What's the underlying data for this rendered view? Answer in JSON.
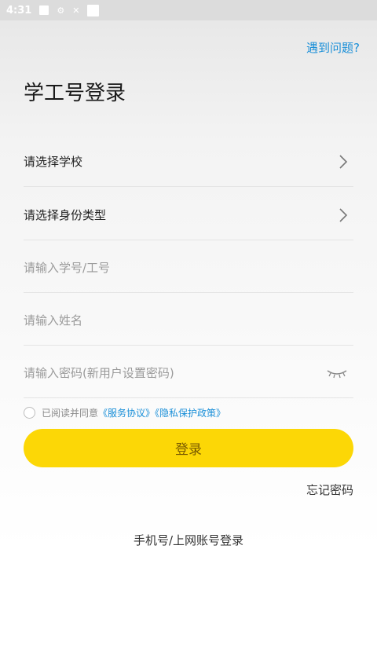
{
  "status_bar": {
    "time": "4:31"
  },
  "header": {
    "help_link": "遇到问题?",
    "title": "学工号登录"
  },
  "form": {
    "school_select": "请选择学校",
    "identity_select": "请选择身份类型",
    "id_placeholder": "请输入学号/工号",
    "name_placeholder": "请输入姓名",
    "password_placeholder": "请输入密码(新用户设置密码)"
  },
  "agreement": {
    "prefix": "已阅读并同意",
    "service_link": "《服务协议》",
    "privacy_link": "《隐私保护政策》"
  },
  "actions": {
    "login_label": "登录",
    "forgot_label": "忘记密码",
    "alt_login_label": "手机号/上网账号登录"
  },
  "colors": {
    "accent": "#fcd706",
    "link": "#1a8fd8"
  }
}
